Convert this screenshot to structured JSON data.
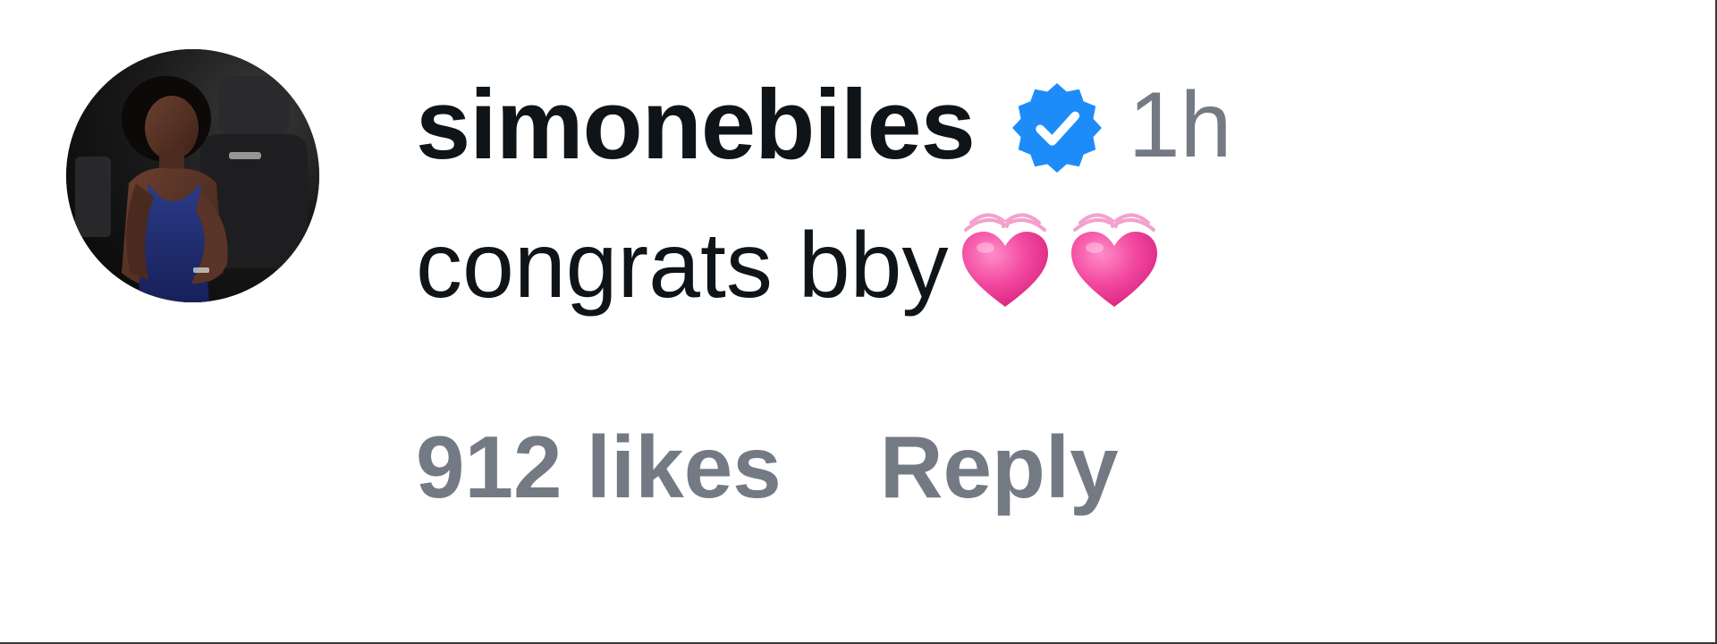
{
  "comment": {
    "avatar_icon": "user-profile-photo",
    "username": "simonebiles",
    "verified": true,
    "verified_icon": "verified-badge-icon",
    "verified_color": "#1d8cf8",
    "timestamp": "1h",
    "text": "congrats bby",
    "emojis": [
      "💗",
      "💗"
    ],
    "emoji_icon": "growing-heart-icon",
    "emoji_color": "#ee3f9c",
    "likes_label": "912 likes",
    "reply_label": "Reply"
  },
  "colors": {
    "primary_text": "#0f1419",
    "secondary_text": "#737a84",
    "background": "#ffffff"
  }
}
